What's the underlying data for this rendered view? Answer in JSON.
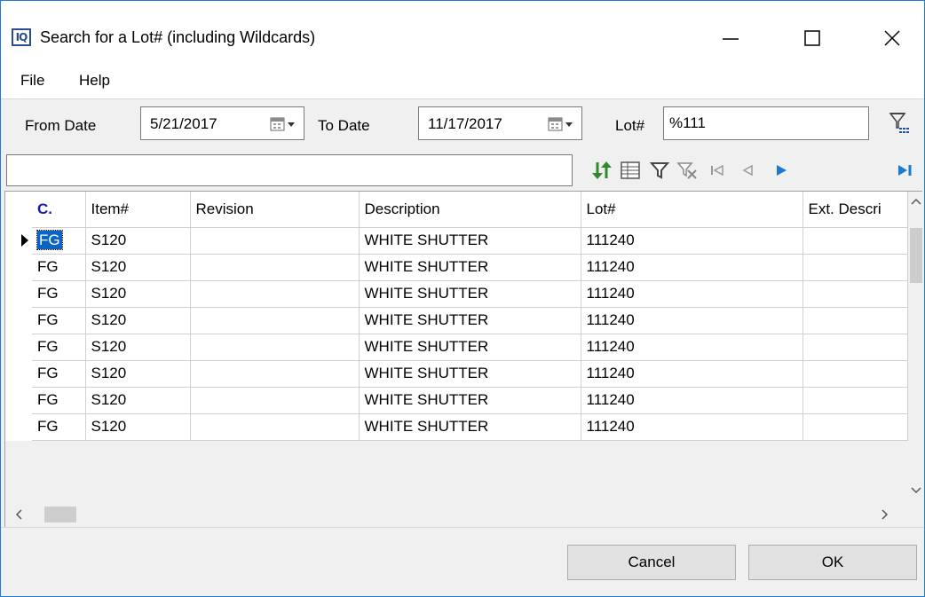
{
  "window": {
    "title": "Search for a Lot# (including Wildcards)",
    "app_icon_text": "IQ"
  },
  "menu": {
    "file": "File",
    "help": "Help"
  },
  "filters": {
    "from_date_label": "From Date",
    "from_date_value": "5/21/2017",
    "to_date_label": "To Date",
    "to_date_value": "11/17/2017",
    "lot_label": "Lot#",
    "lot_value": "%111"
  },
  "search": {
    "value": ""
  },
  "grid": {
    "columns": [
      "C.",
      "Item#",
      "Revision",
      "Description",
      "Lot#",
      "Ext. Descri"
    ],
    "rows": [
      [
        "FG",
        "S120",
        "",
        "WHITE SHUTTER",
        "111240",
        ""
      ],
      [
        "FG",
        "S120",
        "",
        "WHITE SHUTTER",
        "111240",
        ""
      ],
      [
        "FG",
        "S120",
        "",
        "WHITE SHUTTER",
        "111240",
        ""
      ],
      [
        "FG",
        "S120",
        "",
        "WHITE SHUTTER",
        "111240",
        ""
      ],
      [
        "FG",
        "S120",
        "",
        "WHITE SHUTTER",
        "111240",
        ""
      ],
      [
        "FG",
        "S120",
        "",
        "WHITE SHUTTER",
        "111240",
        ""
      ],
      [
        "FG",
        "S120",
        "",
        "WHITE SHUTTER",
        "111240",
        ""
      ],
      [
        "FG",
        "S120",
        "",
        "WHITE SHUTTER",
        "111240",
        ""
      ]
    ],
    "selected_row": 0,
    "selected_color": "#0a64c8"
  },
  "buttons": {
    "cancel": "Cancel",
    "ok": "OK"
  },
  "icons": {
    "toolbar": [
      "sort-icon",
      "columns-icon",
      "filter-icon",
      "clear-filter-icon",
      "first-record-icon",
      "prior-record-icon",
      "next-record-icon",
      "last-record-icon"
    ]
  }
}
